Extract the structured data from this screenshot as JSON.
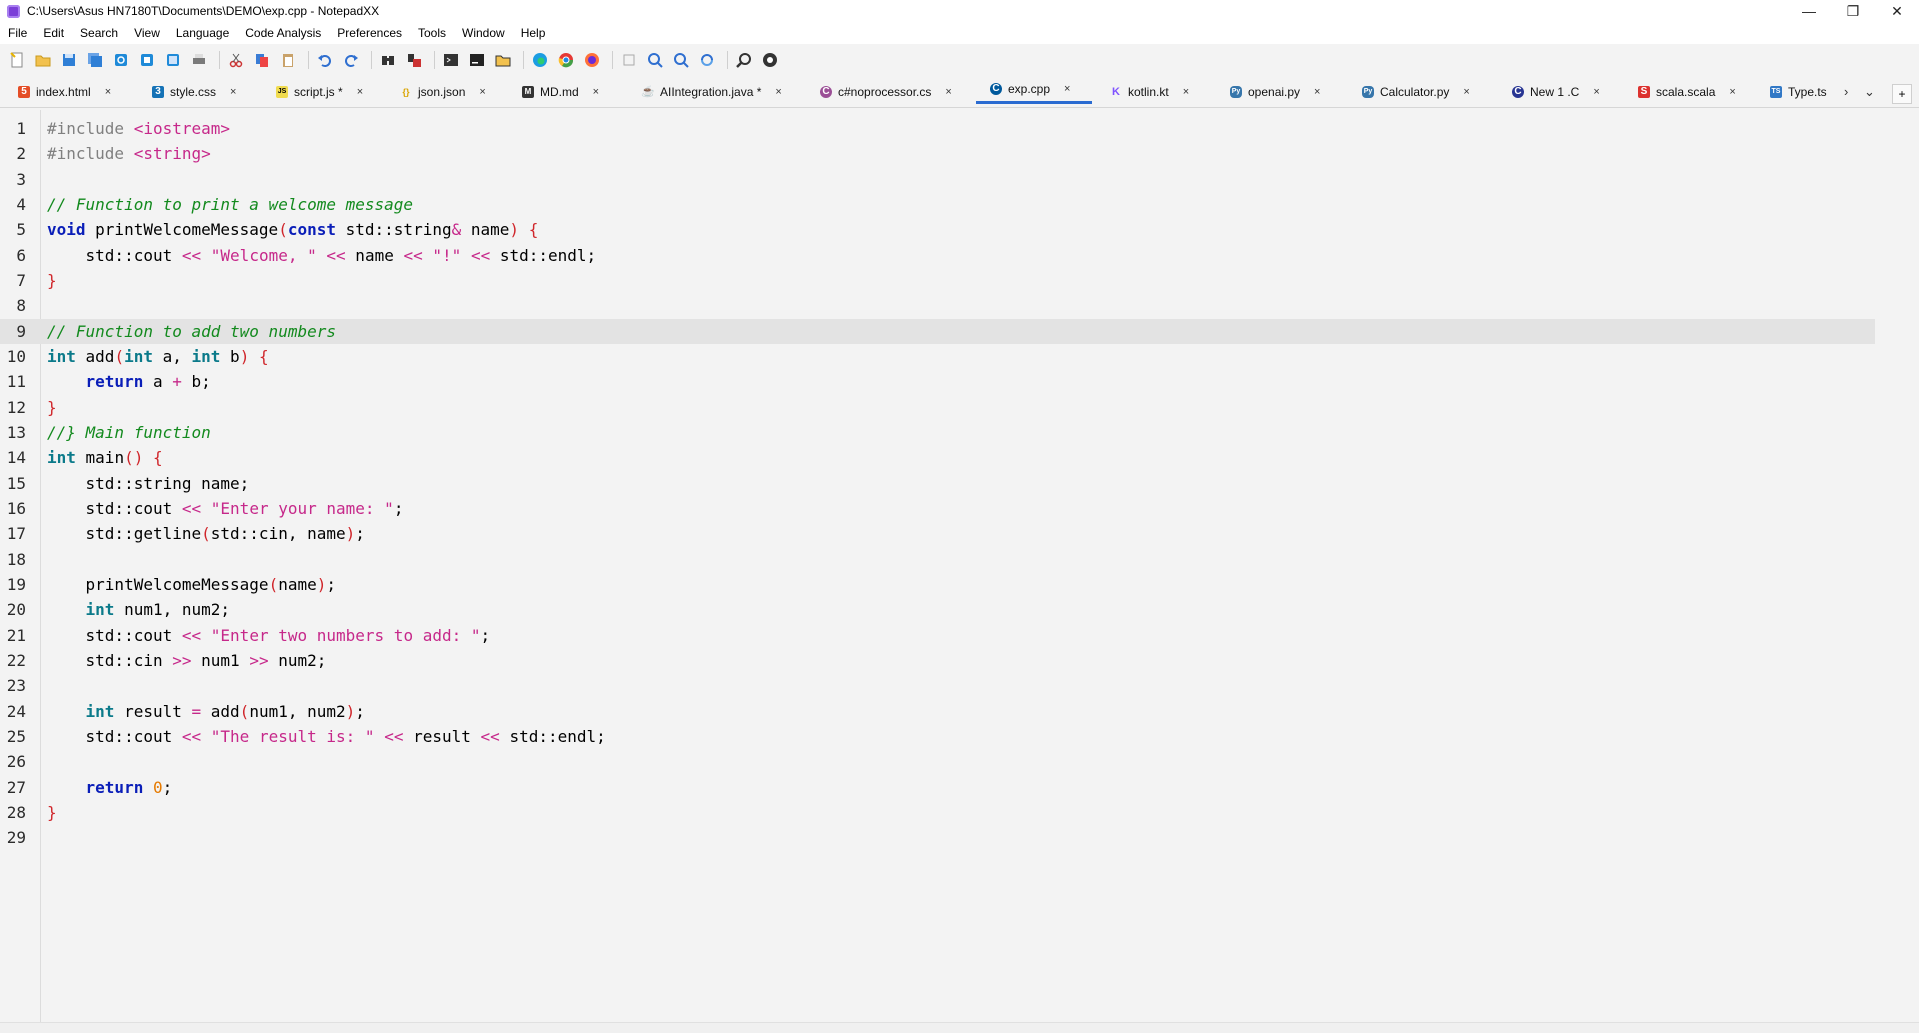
{
  "window": {
    "title": "C:\\Users\\Asus HN7180T\\Documents\\DEMO\\exp.cpp - NotepadXX",
    "controls": [
      "—",
      "❐",
      "✕"
    ]
  },
  "menu": [
    "File",
    "Edit",
    "Search",
    "View",
    "Language",
    "Code Analysis",
    "Preferences",
    "Tools",
    "Window",
    "Help"
  ],
  "toolbar": {
    "icons": [
      "new-file-icon",
      "open-folder-icon",
      "save-icon",
      "save-all-icon",
      "reload-icon",
      "close-icon",
      "close-all-icon",
      "print-icon",
      "cut-icon",
      "copy-icon",
      "paste-icon",
      "undo-icon",
      "redo-icon",
      "find-icon",
      "replace-icon",
      "terminal-icon",
      "console-icon",
      "explorer-icon",
      "edge-icon",
      "chrome-icon",
      "firefox-icon",
      "wrap-icon",
      "zoom-in-icon",
      "zoom-out-icon",
      "sync-icon",
      "find-in-files-icon",
      "record-icon"
    ]
  },
  "tabs": [
    {
      "name": "index.html",
      "icon": "html",
      "color": "#e44d26",
      "glyph": "5"
    },
    {
      "name": "style.css",
      "icon": "css",
      "color": "#1572b6",
      "glyph": "3"
    },
    {
      "name": "script.js *",
      "icon": "js",
      "color": "#f0db4f",
      "glyph": "JS"
    },
    {
      "name": "json.json",
      "icon": "json",
      "color": "#d9a400",
      "glyph": "{}"
    },
    {
      "name": "MD.md",
      "icon": "md",
      "color": "#333333",
      "glyph": "M"
    },
    {
      "name": "AIIntegration.java *",
      "icon": "java",
      "color": "#e76f00",
      "glyph": "☕"
    },
    {
      "name": "c#noprocessor.cs",
      "icon": "cs",
      "color": "#9b4f96",
      "glyph": "C"
    },
    {
      "name": "exp.cpp",
      "icon": "cpp",
      "color": "#00599c",
      "glyph": "C",
      "active": true
    },
    {
      "name": "kotlin.kt",
      "icon": "kotlin",
      "color": "#7f52ff",
      "glyph": "K"
    },
    {
      "name": "openai.py",
      "icon": "python",
      "color": "#3776ab",
      "glyph": "Py"
    },
    {
      "name": "Calculator.py",
      "icon": "python",
      "color": "#3776ab",
      "glyph": "Py"
    },
    {
      "name": "New 1 .C",
      "icon": "c",
      "color": "#283593",
      "glyph": "C"
    },
    {
      "name": "scala.scala",
      "icon": "scala",
      "color": "#dc322f",
      "glyph": "S"
    },
    {
      "name": "Type.ts",
      "icon": "ts",
      "color": "#3178c6",
      "glyph": "TS"
    }
  ],
  "tab_close": "×",
  "editor": {
    "current_line": 9,
    "lines": [
      {
        "n": "1",
        "code": "#include <iostream>"
      },
      {
        "n": "2",
        "code": "#include <string>"
      },
      {
        "n": "3",
        "code": ""
      },
      {
        "n": "4",
        "code": "// Function to print a welcome message"
      },
      {
        "n": "5",
        "code": "void printWelcomeMessage(const std::string& name) {"
      },
      {
        "n": "6",
        "code": "    std::cout << \"Welcome, \" << name << \"!\" << std::endl;"
      },
      {
        "n": "7",
        "code": "}"
      },
      {
        "n": "8",
        "code": ""
      },
      {
        "n": "9",
        "code": "// Function to add two numbers"
      },
      {
        "n": "10",
        "code": "int add(int a, int b) {"
      },
      {
        "n": "11",
        "code": "    return a + b;"
      },
      {
        "n": "12",
        "code": "}"
      },
      {
        "n": "13",
        "code": "//} Main function"
      },
      {
        "n": "14",
        "code": "int main() {"
      },
      {
        "n": "15",
        "code": "    std::string name;"
      },
      {
        "n": "16",
        "code": "    std::cout << \"Enter your name: \";"
      },
      {
        "n": "17",
        "code": "    std::getline(std::cin, name);"
      },
      {
        "n": "18",
        "code": ""
      },
      {
        "n": "19",
        "code": "    printWelcomeMessage(name);"
      },
      {
        "n": "20",
        "code": "    int num1, num2;"
      },
      {
        "n": "21",
        "code": "    std::cout << \"Enter two numbers to add: \";"
      },
      {
        "n": "22",
        "code": "    std::cin >> num1 >> num2;"
      },
      {
        "n": "23",
        "code": ""
      },
      {
        "n": "24",
        "code": "    int result = add(num1, num2);"
      },
      {
        "n": "25",
        "code": "    std::cout << \"The result is: \" << result << std::endl;"
      },
      {
        "n": "26",
        "code": ""
      },
      {
        "n": "27",
        "code": "    return 0;"
      },
      {
        "n": "28",
        "code": "}"
      },
      {
        "n": "29",
        "code": ""
      }
    ]
  }
}
